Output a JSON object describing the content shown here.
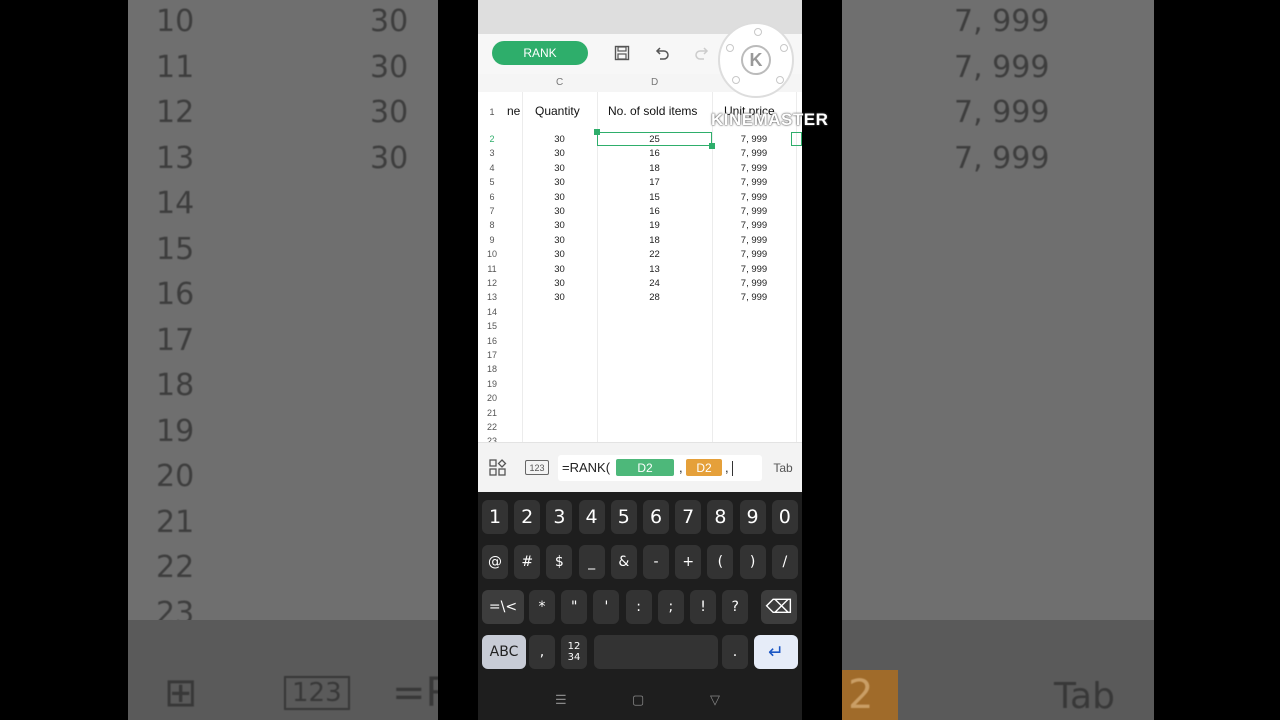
{
  "background": {
    "left_rows": [
      "10",
      "11",
      "12",
      "13",
      "14",
      "15",
      "16",
      "17",
      "18",
      "19",
      "20",
      "21",
      "22",
      "23"
    ],
    "left_quantity": [
      "30",
      "30",
      "30",
      "30"
    ],
    "right_prices": [
      "7, 999",
      "7, 999",
      "7, 999",
      "7, 999"
    ],
    "bottom_left_text": "=R",
    "bottom_right_chip": "2",
    "bottom_right_tab": "Tab"
  },
  "toolbar": {
    "rank_label": "RANK"
  },
  "column_letters": [
    "C",
    "D"
  ],
  "headers": {
    "col_b_partial": "ne",
    "quantity": "Quantity",
    "sold_items": "No. of sold items",
    "unit_price": "Unit price"
  },
  "row_numbers": [
    "1",
    "2",
    "3",
    "4",
    "5",
    "6",
    "7",
    "8",
    "9",
    "10",
    "11",
    "12",
    "13",
    "14",
    "15",
    "16",
    "17",
    "18",
    "19",
    "20",
    "21",
    "22",
    "23"
  ],
  "rows": [
    {
      "quantity": "30",
      "sold": "25",
      "price": "7, 999"
    },
    {
      "quantity": "30",
      "sold": "16",
      "price": "7, 999"
    },
    {
      "quantity": "30",
      "sold": "18",
      "price": "7, 999"
    },
    {
      "quantity": "30",
      "sold": "17",
      "price": "7, 999"
    },
    {
      "quantity": "30",
      "sold": "15",
      "price": "7, 999"
    },
    {
      "quantity": "30",
      "sold": "16",
      "price": "7, 999"
    },
    {
      "quantity": "30",
      "sold": "19",
      "price": "7, 999"
    },
    {
      "quantity": "30",
      "sold": "18",
      "price": "7, 999"
    },
    {
      "quantity": "30",
      "sold": "22",
      "price": "7, 999"
    },
    {
      "quantity": "30",
      "sold": "13",
      "price": "7, 999"
    },
    {
      "quantity": "30",
      "sold": "24",
      "price": "7, 999"
    },
    {
      "quantity": "30",
      "sold": "28",
      "price": "7, 999"
    }
  ],
  "watermark": "KINEMASTER",
  "formula": {
    "prefix": "=RANK(",
    "chip1": "D2",
    "sep1": ",",
    "chip2": "D2",
    "sep2": ",",
    "tab_label": "Tab",
    "num_mode_label": "123",
    "chip1_color": "#4db87a",
    "chip2_color": "#e5a03a"
  },
  "keyboard": {
    "row1": [
      "1",
      "2",
      "3",
      "4",
      "5",
      "6",
      "7",
      "8",
      "9",
      "0"
    ],
    "row2": [
      "@",
      "#",
      "$",
      "_",
      "&",
      "-",
      "+",
      "(",
      ")",
      "/"
    ],
    "row3": [
      "=\\<",
      "*",
      "\"",
      "'",
      ":",
      ";",
      "!",
      "?"
    ],
    "abc_label": "ABC",
    "comma": ",",
    "numpad_label": "12\n34",
    "period": ".",
    "enter_symbol": "↵",
    "backspace_symbol": "⌫"
  },
  "colors": {
    "accent": "#2eae6b"
  }
}
